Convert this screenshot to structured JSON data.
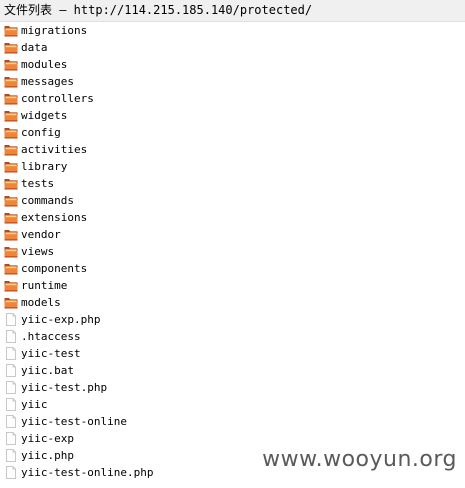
{
  "window": {
    "title": "文件列表 — http://114.215.185.140/protected/"
  },
  "colors": {
    "folder_dark": "#b34a1f",
    "folder_mid": "#f0843a",
    "folder_light": "#ffd080",
    "file_fill": "#ffffff",
    "file_border": "#c8c8c8"
  },
  "entries": [
    {
      "name": "migrations",
      "icon": "folder-icon",
      "type": "folder"
    },
    {
      "name": "data",
      "icon": "folder-icon",
      "type": "folder"
    },
    {
      "name": "modules",
      "icon": "folder-icon",
      "type": "folder"
    },
    {
      "name": "messages",
      "icon": "folder-icon",
      "type": "folder"
    },
    {
      "name": "controllers",
      "icon": "folder-icon",
      "type": "folder"
    },
    {
      "name": "widgets",
      "icon": "folder-icon",
      "type": "folder"
    },
    {
      "name": "config",
      "icon": "folder-icon",
      "type": "folder"
    },
    {
      "name": "activities",
      "icon": "folder-icon",
      "type": "folder"
    },
    {
      "name": "library",
      "icon": "folder-icon",
      "type": "folder"
    },
    {
      "name": "tests",
      "icon": "folder-icon",
      "type": "folder"
    },
    {
      "name": "commands",
      "icon": "folder-icon",
      "type": "folder"
    },
    {
      "name": "extensions",
      "icon": "folder-icon",
      "type": "folder"
    },
    {
      "name": "vendor",
      "icon": "folder-icon",
      "type": "folder"
    },
    {
      "name": "views",
      "icon": "folder-icon",
      "type": "folder"
    },
    {
      "name": "components",
      "icon": "folder-icon",
      "type": "folder"
    },
    {
      "name": "runtime",
      "icon": "folder-icon",
      "type": "folder"
    },
    {
      "name": "models",
      "icon": "folder-icon",
      "type": "folder"
    },
    {
      "name": "yiic-exp.php",
      "icon": "file-icon",
      "type": "file"
    },
    {
      "name": ".htaccess",
      "icon": "file-icon",
      "type": "file"
    },
    {
      "name": "yiic-test",
      "icon": "file-icon",
      "type": "file"
    },
    {
      "name": "yiic.bat",
      "icon": "file-icon",
      "type": "file"
    },
    {
      "name": "yiic-test.php",
      "icon": "file-icon",
      "type": "file"
    },
    {
      "name": "yiic",
      "icon": "file-icon",
      "type": "file"
    },
    {
      "name": "yiic-test-online",
      "icon": "file-icon",
      "type": "file"
    },
    {
      "name": "yiic-exp",
      "icon": "file-icon",
      "type": "file"
    },
    {
      "name": "yiic.php",
      "icon": "file-icon",
      "type": "file"
    },
    {
      "name": "yiic-test-online.php",
      "icon": "file-icon",
      "type": "file"
    }
  ],
  "watermark": "www.wooyun.org"
}
